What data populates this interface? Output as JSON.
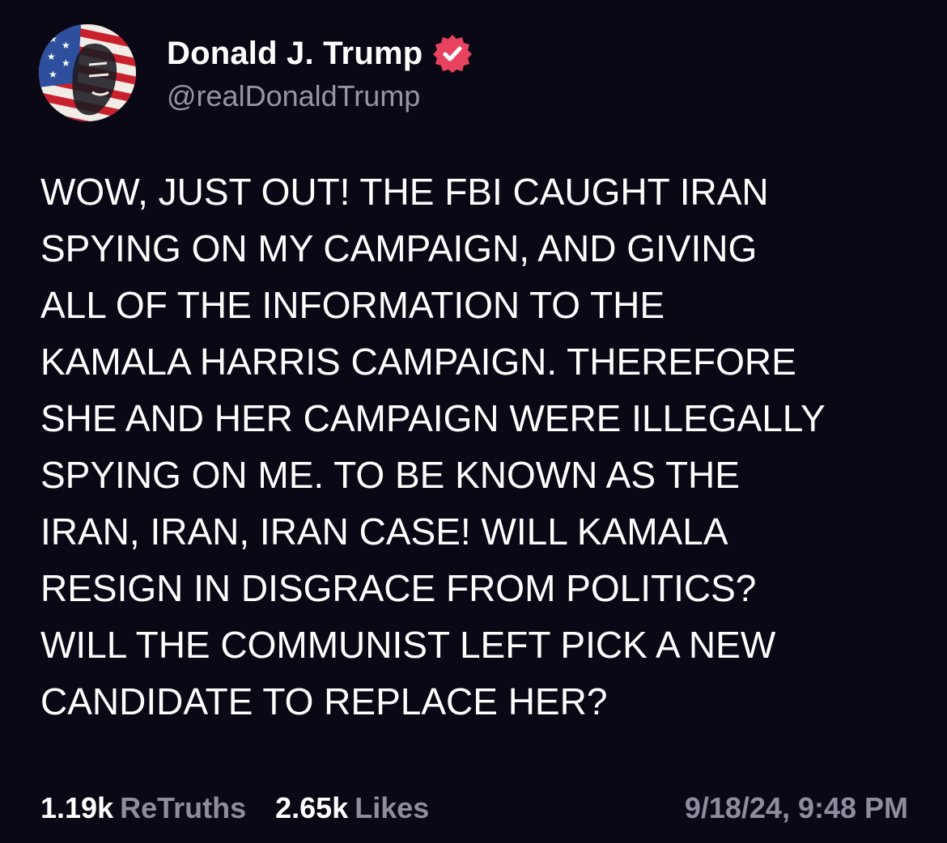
{
  "author": {
    "display_name": "Donald J. Trump",
    "handle": "@realDonaldTrump",
    "verified": true,
    "verified_badge_color": "#e8435e"
  },
  "post": {
    "lines": [
      "WOW, JUST OUT! THE FBI CAUGHT IRAN",
      "SPYING ON MY CAMPAIGN, AND GIVING",
      "ALL OF THE INFORMATION TO THE",
      "KAMALA HARRIS CAMPAIGN. THEREFORE",
      "SHE AND HER CAMPAIGN WERE ILLEGALLY",
      "SPYING ON ME. TO BE KNOWN AS THE",
      "IRAN, IRAN, IRAN CASE! WILL KAMALA",
      "RESIGN IN DISGRACE FROM POLITICS?",
      "WILL THE COMMUNIST LEFT PICK A NEW",
      "CANDIDATE TO REPLACE HER?"
    ]
  },
  "stats": {
    "retruths_count": "1.19k",
    "retruths_label": "ReTruths",
    "likes_count": "2.65k",
    "likes_label": "Likes"
  },
  "timestamp": "9/18/24, 9:48 PM",
  "icons": {
    "avatar": "flag-portrait-avatar",
    "verified": "verified-badge-icon"
  },
  "colors": {
    "background": "#0b0816",
    "text": "#ffffff",
    "muted": "#8f8c9e"
  }
}
